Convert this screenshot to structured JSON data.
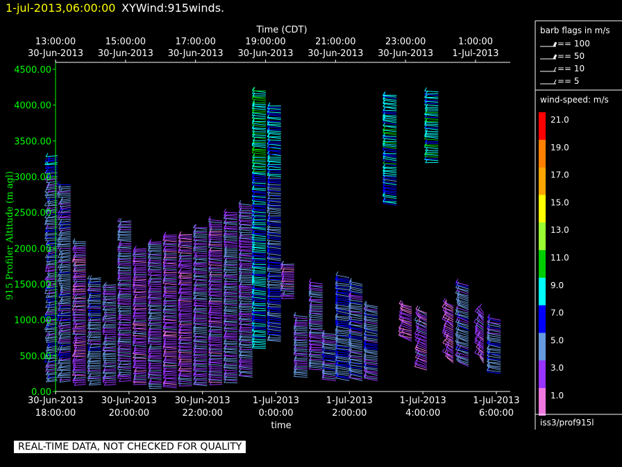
{
  "header": {
    "date_label": "1-jul-2013,06:00:00",
    "plot_name": "XYWind:915winds."
  },
  "quality_banner": "REAL-TIME DATA, NOT CHECKED FOR QUALITY",
  "source_label": "iss3/prof915l",
  "colors": {
    "background": "#000000",
    "axis_y": "#00ff00",
    "axis_x": "#ffffff",
    "date_title": "#ffff00"
  },
  "chart_data": {
    "type": "wind-barb",
    "top_axis_title": "Time (CDT)",
    "bottom_axis_title": "time",
    "ylabel": "915 Profiler Altitude (m agl)",
    "ylim": [
      0,
      4500
    ],
    "yticks": [
      "0.00",
      "500.00",
      "1000.00",
      "1500.00",
      "2000.00",
      "2500.00",
      "3000.00",
      "3500.00",
      "4000.00",
      "4500.00"
    ],
    "xlim_hours": [
      18,
      30
    ],
    "top_ticks": [
      {
        "time": "13:00:00",
        "date": "30-Jun-2013"
      },
      {
        "time": "15:00:00",
        "date": "30-Jun-2013"
      },
      {
        "time": "17:00:00",
        "date": "30-Jun-2013"
      },
      {
        "time": "19:00:00",
        "date": "30-Jun-2013"
      },
      {
        "time": "21:00:00",
        "date": "30-Jun-2013"
      },
      {
        "time": "23:00:00",
        "date": "30-Jun-2013"
      },
      {
        "time": "1:00:00",
        "date": "1-Jul-2013"
      }
    ],
    "bottom_ticks": [
      {
        "date": "30-Jun-2013",
        "time": "18:00:00"
      },
      {
        "date": "30-Jun-2013",
        "time": "20:00:00"
      },
      {
        "date": "30-Jun-2013",
        "time": "22:00:00"
      },
      {
        "date": "1-Jul-2013",
        "time": "0:00:00"
      },
      {
        "date": "1-Jul-2013",
        "time": "2:00:00"
      },
      {
        "date": "1-Jul-2013",
        "time": "4:00:00"
      },
      {
        "date": "1-Jul-2013",
        "time": "6:00:00"
      }
    ],
    "barb_legend": {
      "title": "barb flags in m/s",
      "entries": [
        {
          "label": "== 100",
          "value": 100
        },
        {
          "label": "== 50",
          "value": 50
        },
        {
          "label": "== 10",
          "value": 10
        },
        {
          "label": "== 5",
          "value": 5
        }
      ]
    },
    "color_scale": {
      "title": "wind-speed: m/s",
      "bins": [
        {
          "label": "21.0",
          "color": "#ff0000"
        },
        {
          "label": "19.0",
          "color": "#ff8000"
        },
        {
          "label": "17.0",
          "color": "#ffa500"
        },
        {
          "label": "15.0",
          "color": "#ffff00"
        },
        {
          "label": "13.0",
          "color": "#99ff33"
        },
        {
          "label": "11.0",
          "color": "#00cc00"
        },
        {
          "label": "9.0",
          "color": "#00ffff"
        },
        {
          "label": "7.0",
          "color": "#0000ff"
        },
        {
          "label": "5.0",
          "color": "#6699dd"
        },
        {
          "label": "3.0",
          "color": "#9933ff"
        },
        {
          "label": "1.0",
          "color": "#ee77dd"
        }
      ]
    },
    "profiles": [
      {
        "t": 18.05,
        "z0": 150,
        "z1": 3300,
        "dir": 235,
        "spd": 5
      },
      {
        "t": 18.4,
        "z0": 150,
        "z1": 2900,
        "dir": 240,
        "spd": 5
      },
      {
        "t": 18.8,
        "z0": 100,
        "z1": 2100,
        "dir": 245,
        "spd": 3
      },
      {
        "t": 19.2,
        "z0": 100,
        "z1": 1600,
        "dir": 250,
        "spd": 5
      },
      {
        "t": 19.6,
        "z0": 100,
        "z1": 1500,
        "dir": 250,
        "spd": 4
      },
      {
        "t": 20.0,
        "z0": 150,
        "z1": 2400,
        "dir": 255,
        "spd": 4
      },
      {
        "t": 20.4,
        "z0": 100,
        "z1": 2000,
        "dir": 255,
        "spd": 3
      },
      {
        "t": 20.8,
        "z0": 50,
        "z1": 2100,
        "dir": 255,
        "spd": 4
      },
      {
        "t": 21.2,
        "z0": 50,
        "z1": 2200,
        "dir": 258,
        "spd": 3
      },
      {
        "t": 21.6,
        "z0": 80,
        "z1": 2200,
        "dir": 258,
        "spd": 3
      },
      {
        "t": 22.0,
        "z0": 80,
        "z1": 2300,
        "dir": 258,
        "spd": 4
      },
      {
        "t": 22.4,
        "z0": 100,
        "z1": 2400,
        "dir": 260,
        "spd": 3
      },
      {
        "t": 22.8,
        "z0": 120,
        "z1": 2500,
        "dir": 260,
        "spd": 4
      },
      {
        "t": 23.2,
        "z0": 200,
        "z1": 2600,
        "dir": 262,
        "spd": 4
      },
      {
        "t": 23.55,
        "z0": 600,
        "z1": 4200,
        "dir": 265,
        "spd": 8
      },
      {
        "t": 23.95,
        "z0": 700,
        "z1": 4000,
        "dir": 265,
        "spd": 6
      },
      {
        "t": 24.3,
        "z0": 1300,
        "z1": 1800,
        "dir": 250,
        "spd": 3
      },
      {
        "t": 24.65,
        "z0": 200,
        "z1": 1050,
        "dir": 260,
        "spd": 4
      },
      {
        "t": 25.05,
        "z0": 300,
        "z1": 1500,
        "dir": 265,
        "spd": 4
      },
      {
        "t": 25.4,
        "z0": 150,
        "z1": 800,
        "dir": 270,
        "spd": 5
      },
      {
        "t": 25.75,
        "z0": 150,
        "z1": 1600,
        "dir": 275,
        "spd": 6
      },
      {
        "t": 26.1,
        "z0": 150,
        "z1": 1500,
        "dir": 280,
        "spd": 5
      },
      {
        "t": 26.5,
        "z0": 150,
        "z1": 1200,
        "dir": 285,
        "spd": 5
      },
      {
        "t": 27.0,
        "z0": 2600,
        "z1": 4150,
        "dir": 270,
        "spd": 7
      },
      {
        "t": 27.4,
        "z0": 700,
        "z1": 1200,
        "dir": 300,
        "spd": 2
      },
      {
        "t": 27.8,
        "z0": 300,
        "z1": 1100,
        "dir": 310,
        "spd": 3
      },
      {
        "t": 28.1,
        "z0": 3200,
        "z1": 4200,
        "dir": 260,
        "spd": 7
      },
      {
        "t": 28.5,
        "z0": 400,
        "z1": 1200,
        "dir": 320,
        "spd": 2
      },
      {
        "t": 28.9,
        "z0": 350,
        "z1": 1500,
        "dir": 300,
        "spd": 5
      },
      {
        "t": 29.3,
        "z0": 400,
        "z1": 1100,
        "dir": 330,
        "spd": 3
      },
      {
        "t": 29.75,
        "z0": 250,
        "z1": 1000,
        "dir": 280,
        "spd": 5
      }
    ]
  }
}
